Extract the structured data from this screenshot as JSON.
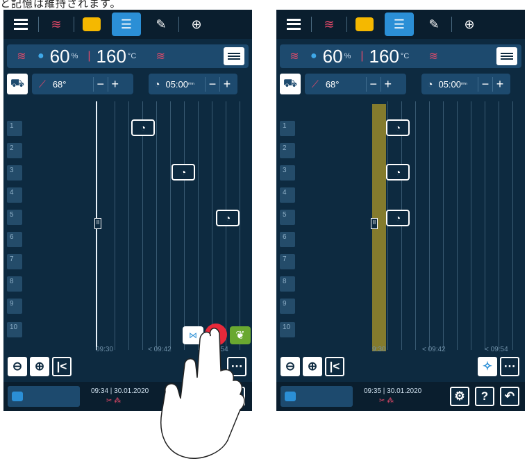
{
  "caption": "と記憶は維持されます。",
  "left": {
    "climate": {
      "humidity": "60",
      "humidity_unit": "%",
      "temp": "160",
      "temp_unit": "°C"
    },
    "row2": {
      "core_temp": "68°",
      "timer": "05:00",
      "timer_unit": "ᵐⁱⁿ",
      "minus": "−",
      "plus": "+"
    },
    "racks": [
      "1",
      "2",
      "3",
      "4",
      "5",
      "6",
      "7",
      "8",
      "9",
      "10"
    ],
    "timelabels": [
      "09:30",
      "< 09:42",
      "< 09:54"
    ],
    "footer": {
      "time": "09:34 | 30.01.2020"
    }
  },
  "right": {
    "climate": {
      "humidity": "60",
      "humidity_unit": "%",
      "temp": "160",
      "temp_unit": "°C"
    },
    "row2": {
      "core_temp": "68°",
      "timer": "05:00",
      "timer_unit": "ᵐⁱⁿ",
      "minus": "−",
      "plus": "+"
    },
    "racks": [
      "1",
      "2",
      "3",
      "4",
      "5",
      "6",
      "7",
      "8",
      "9",
      "10"
    ],
    "timelabels": [
      "9:30",
      "< 09:42",
      "< 09:54"
    ],
    "footer": {
      "time": "09:35 | 30.01.2020"
    },
    "buttons": {
      "settings": "⚙",
      "help": "?",
      "back": "↶"
    }
  },
  "icons": {
    "menu": "menu-icon",
    "combi": "combi-mode-icon",
    "tab_active": "cooking-path-icon",
    "edit": "edit-icon",
    "ai": "ai-icon",
    "zoom_out": "zoom-out-icon",
    "zoom_in": "zoom-in-icon",
    "back_start": "jump-start-icon",
    "more": "more-icon"
  },
  "colors": {
    "background": "#0d2a40",
    "accent": "#2b8fd6",
    "yellow": "#f5b800",
    "red": "#e8293a",
    "band": "#9a8a2a"
  }
}
